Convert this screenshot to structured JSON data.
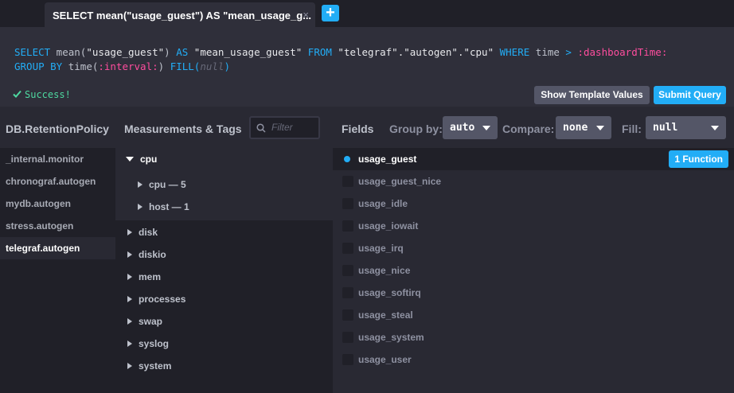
{
  "tab": {
    "label": "SELECT mean(\"usage_guest\") AS \"mean_usage_g...",
    "close": "×",
    "add": "+"
  },
  "query": {
    "l1_select": "SELECT",
    "l1_fn": " mean(",
    "l1_field": "\"usage_guest\"",
    "l1_close": ") ",
    "l1_as": "AS",
    "l1_alias": " \"mean_usage_guest\" ",
    "l1_from": "FROM",
    "l1_src": " \"telegraf\".\"autogen\".\"cpu\" ",
    "l1_where": "WHERE",
    "l1_time": " time ",
    "l1_gt": ">",
    "l1_tv": " :dashboardTime:",
    "l2_group": "GROUP BY",
    "l2_time": " time(",
    "l2_interval": ":interval:",
    "l2_close": ") ",
    "l2_fill": "FILL(",
    "l2_null": "null",
    "l2_end": ")"
  },
  "status": {
    "icon": "check-icon",
    "text": "Success!"
  },
  "buttons": {
    "template": "Show Template Values",
    "submit": "Submit Query"
  },
  "headers": {
    "db": "DB.RetentionPolicy",
    "measurements": "Measurements & Tags",
    "filter_placeholder": "Filter",
    "fields": "Fields",
    "group_by_label": "Group by:",
    "group_by_value": "auto",
    "compare_label": "Compare:",
    "compare_value": "none",
    "fill_label": "Fill:",
    "fill_value": "null"
  },
  "databases": [
    "_internal.monitor",
    "chronograf.autogen",
    "mydb.autogen",
    "stress.autogen",
    "telegraf.autogen"
  ],
  "measurements": {
    "cpu": "cpu",
    "cpu_tags": [
      "cpu — 5",
      "host — 1"
    ],
    "others": [
      "disk",
      "diskio",
      "mem",
      "processes",
      "swap",
      "syslog",
      "system"
    ]
  },
  "fields": [
    "usage_guest",
    "usage_guest_nice",
    "usage_idle",
    "usage_iowait",
    "usage_irq",
    "usage_nice",
    "usage_softirq",
    "usage_steal",
    "usage_system",
    "usage_user"
  ],
  "function_badge": "1 Function",
  "colors": {
    "accent": "#22adf6",
    "success": "#4ed8a0",
    "template": "#ff4d9e"
  }
}
